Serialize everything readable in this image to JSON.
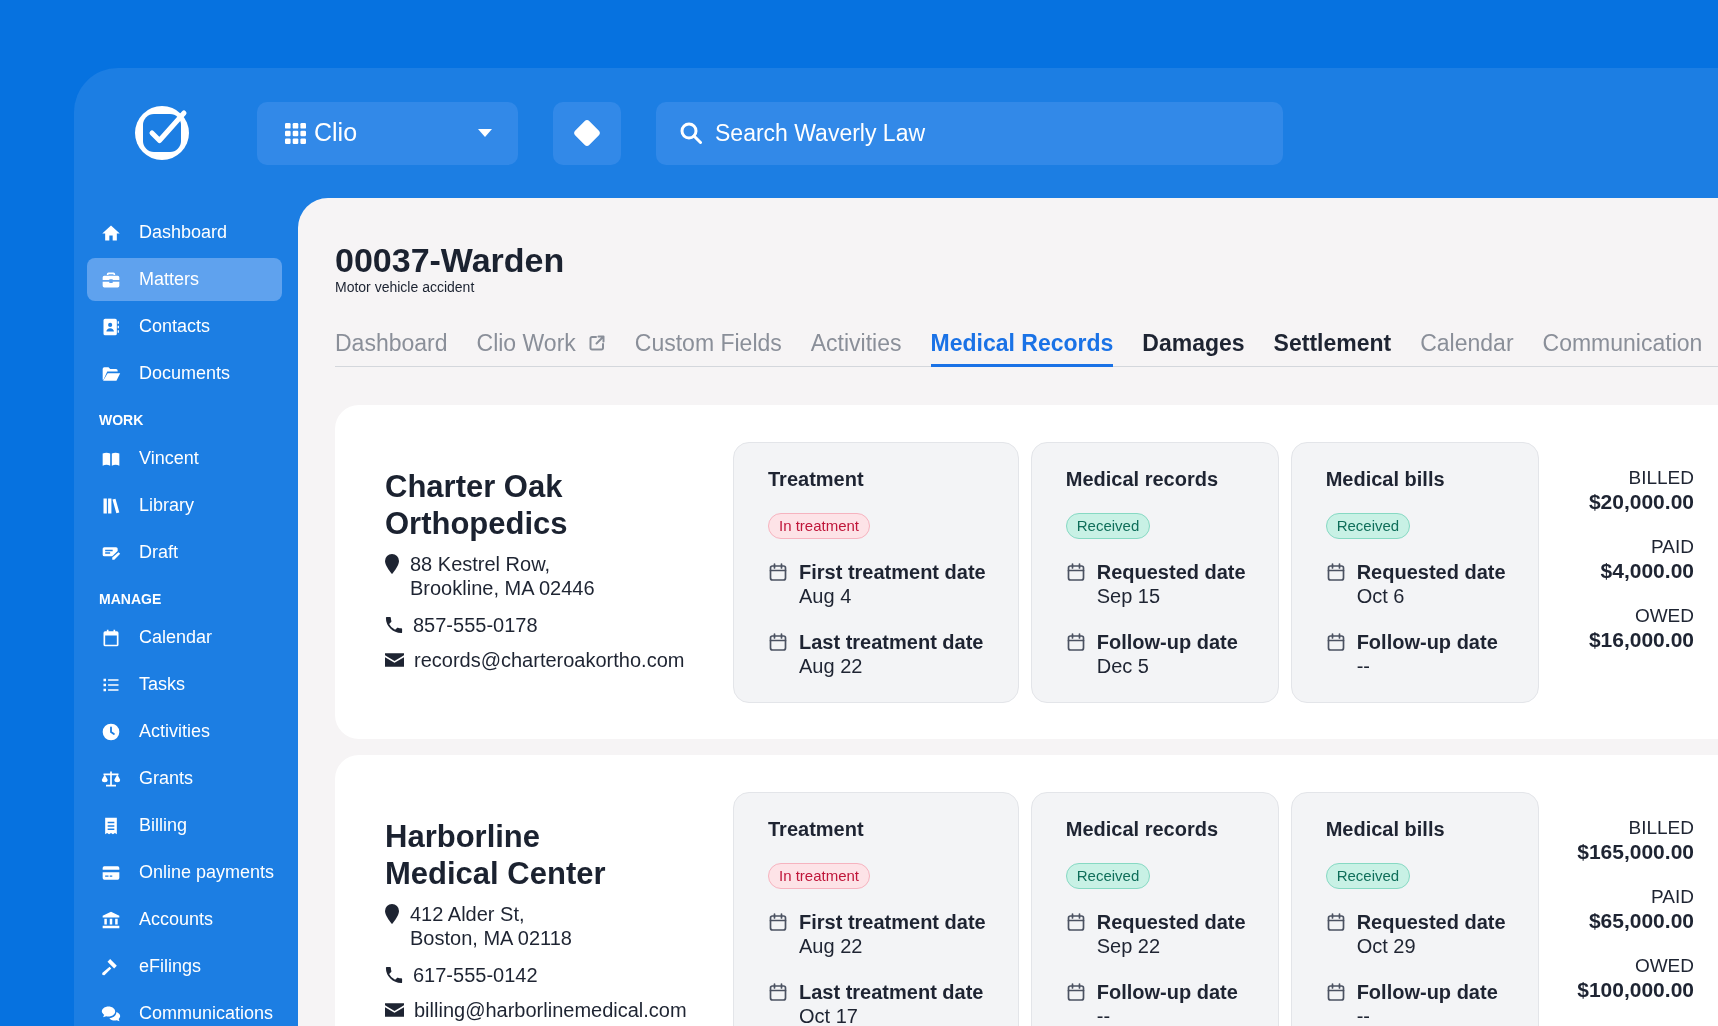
{
  "header": {
    "switcher": {
      "label": "Clio"
    },
    "search": {
      "placeholder": "Search Waverly Law"
    }
  },
  "sidebar": {
    "sections": [
      {
        "items": [
          {
            "label": "Dashboard",
            "selected": false
          },
          {
            "label": "Matters",
            "selected": true
          },
          {
            "label": "Contacts",
            "selected": false
          },
          {
            "label": "Documents",
            "selected": false
          }
        ]
      },
      {
        "title": "WORK",
        "items": [
          {
            "label": "Vincent",
            "selected": false
          },
          {
            "label": "Library",
            "selected": false
          },
          {
            "label": "Draft",
            "selected": false
          }
        ]
      },
      {
        "title": "MANAGE",
        "items": [
          {
            "label": "Calendar",
            "selected": false
          },
          {
            "label": "Tasks",
            "selected": false
          },
          {
            "label": "Activities",
            "selected": false
          },
          {
            "label": "Grants",
            "selected": false
          },
          {
            "label": "Billing",
            "selected": false
          },
          {
            "label": "Online payments",
            "selected": false
          },
          {
            "label": "Accounts",
            "selected": false
          },
          {
            "label": "eFilings",
            "selected": false
          },
          {
            "label": "Communications",
            "selected": false
          }
        ]
      }
    ]
  },
  "matter": {
    "title": "00037-Warden",
    "subtitle": "Motor vehicle accident"
  },
  "tabs": [
    {
      "label": "Dashboard",
      "selected": false,
      "emphasized": false,
      "external": false
    },
    {
      "label": "Clio Work",
      "selected": false,
      "emphasized": false,
      "external": true
    },
    {
      "label": "Custom Fields",
      "selected": false,
      "emphasized": false,
      "external": false
    },
    {
      "label": "Activities",
      "selected": false,
      "emphasized": false,
      "external": false
    },
    {
      "label": "Medical Records",
      "selected": true,
      "emphasized": false,
      "external": false
    },
    {
      "label": "Damages",
      "selected": false,
      "emphasized": true,
      "external": false
    },
    {
      "label": "Settlement",
      "selected": false,
      "emphasized": true,
      "external": false
    },
    {
      "label": "Calendar",
      "selected": false,
      "emphasized": false,
      "external": false
    },
    {
      "label": "Communication",
      "selected": false,
      "emphasized": false,
      "external": false
    }
  ],
  "providers": [
    {
      "name": "Charter Oak Orthopedics",
      "address_lines": [
        "88 Kestrel Row,",
        "Brookline, MA 02446"
      ],
      "phone": "857-555-0178",
      "email": "records@charteroakortho.com",
      "panels": [
        {
          "title": "Treatment",
          "status": {
            "label": "In treatment",
            "kind": "warning"
          },
          "dates": [
            {
              "label": "First treatment date",
              "value": "Aug 4"
            },
            {
              "label": "Last treatment date",
              "value": "Aug 22"
            }
          ]
        },
        {
          "title": "Medical records",
          "status": {
            "label": "Received",
            "kind": "success"
          },
          "dates": [
            {
              "label": "Requested date",
              "value": "Sep 15"
            },
            {
              "label": "Follow-up date",
              "value": "Dec 5"
            }
          ]
        },
        {
          "title": "Medical bills",
          "status": {
            "label": "Received",
            "kind": "success"
          },
          "dates": [
            {
              "label": "Requested date",
              "value": "Oct 6"
            },
            {
              "label": "Follow-up date",
              "value": "--"
            }
          ]
        }
      ],
      "amounts": [
        {
          "label": "BILLED",
          "value": "$20,000.00"
        },
        {
          "label": "PAID",
          "value": "$4,000.00"
        },
        {
          "label": "OWED",
          "value": "$16,000.00"
        }
      ]
    },
    {
      "name": "Harborline Medical Center",
      "address_lines": [
        "412 Alder St,",
        "Boston, MA 02118"
      ],
      "phone": "617-555-0142",
      "email": "billing@harborlinemedical.com",
      "panels": [
        {
          "title": "Treatment",
          "status": {
            "label": "In treatment",
            "kind": "warning"
          },
          "dates": [
            {
              "label": "First treatment date",
              "value": "Aug 22"
            },
            {
              "label": "Last treatment date",
              "value": "Oct 17"
            }
          ]
        },
        {
          "title": "Medical records",
          "status": {
            "label": "Received",
            "kind": "success"
          },
          "dates": [
            {
              "label": "Requested date",
              "value": "Sep 22"
            },
            {
              "label": "Follow-up date",
              "value": "--"
            }
          ]
        },
        {
          "title": "Medical bills",
          "status": {
            "label": "Received",
            "kind": "success"
          },
          "dates": [
            {
              "label": "Requested date",
              "value": "Oct 29"
            },
            {
              "label": "Follow-up date",
              "value": "--"
            }
          ]
        }
      ],
      "amounts": [
        {
          "label": "BILLED",
          "value": "$165,000.00"
        },
        {
          "label": "PAID",
          "value": "$65,000.00"
        },
        {
          "label": "OWED",
          "value": "$100,000.00"
        }
      ]
    }
  ]
}
